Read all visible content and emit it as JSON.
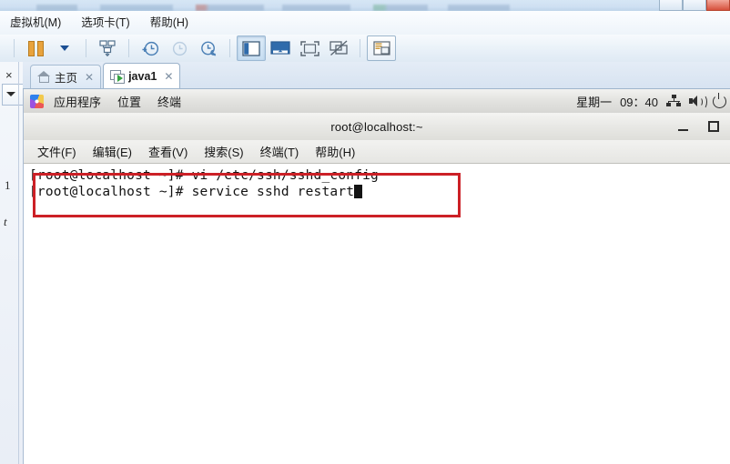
{
  "vmware": {
    "menu": [
      {
        "label": "虚拟机(M)",
        "name": "menu-virtual-machine"
      },
      {
        "label": "选项卡(T)",
        "name": "menu-tabs"
      },
      {
        "label": "帮助(H)",
        "name": "menu-help"
      }
    ],
    "toolbar": {
      "pause": "pause-button",
      "pause_dropdown": "pause-dropdown-caret",
      "manage_snapshot": "manage-vm-icon",
      "take_snapshot": "take-snapshot-icon",
      "revert_snapshot": "revert-snapshot-icon",
      "snapshot_manager": "snapshot-manager-icon",
      "show_library": "show-library-icon",
      "console_view": "console-view-icon",
      "fullscreen": "fullscreen-icon",
      "unity": "unity-mode-icon",
      "preferences": "preferences-icon"
    },
    "tabs": [
      {
        "label": "主页",
        "icon": "home-icon",
        "active": false
      },
      {
        "label": "java1",
        "icon": "vm-icon",
        "active": true
      }
    ],
    "library": {
      "close_label": "×",
      "fragment_1": "1",
      "fragment_2": "t"
    }
  },
  "guest": {
    "panel": {
      "applications": "应用程序",
      "places": "位置",
      "terminal": "终端",
      "day": "星期一",
      "clock": "09：40",
      "network_icon": "network-icon",
      "volume_icon": "volume-icon",
      "power_icon": "power-icon"
    },
    "terminal": {
      "title": "root@localhost:~",
      "minimize": "minimize-button",
      "maximize": "maximize-button",
      "menu": [
        {
          "label": "文件(F)",
          "name": "term-menu-file"
        },
        {
          "label": "编辑(E)",
          "name": "term-menu-edit"
        },
        {
          "label": "查看(V)",
          "name": "term-menu-view"
        },
        {
          "label": "搜索(S)",
          "name": "term-menu-search"
        },
        {
          "label": "终端(T)",
          "name": "term-menu-terminal"
        },
        {
          "label": "帮助(H)",
          "name": "term-menu-help"
        }
      ],
      "lines": [
        "[root@localhost ~]# vi /etc/ssh/sshd_config",
        "[root@localhost ~]# service sshd restart"
      ]
    }
  },
  "annotation": {
    "color": "#cc2026",
    "label": "highlight-rectangle"
  }
}
